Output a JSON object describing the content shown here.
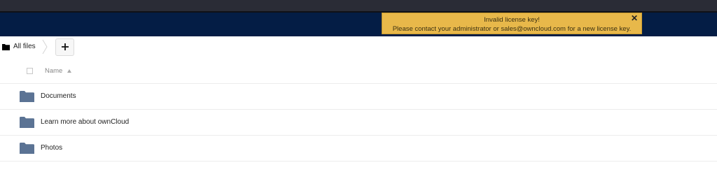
{
  "toast": {
    "title": "Invalid license key!",
    "message": "Please contact your administrator or sales@owncloud.com for a new license key.",
    "close_glyph": "✕"
  },
  "breadcrumb": {
    "home_label": "All files",
    "home_icon": "folder-icon"
  },
  "new_button": {
    "label": "+"
  },
  "table": {
    "name_header": "Name",
    "sort": "ascending"
  },
  "files": [
    {
      "name": "Documents",
      "type": "folder"
    },
    {
      "name": "Learn more about ownCloud",
      "type": "folder"
    },
    {
      "name": "Photos",
      "type": "folder"
    }
  ],
  "colors": {
    "header": "#041d45",
    "toast": "#e8b84a",
    "folder": "#5b7394"
  }
}
